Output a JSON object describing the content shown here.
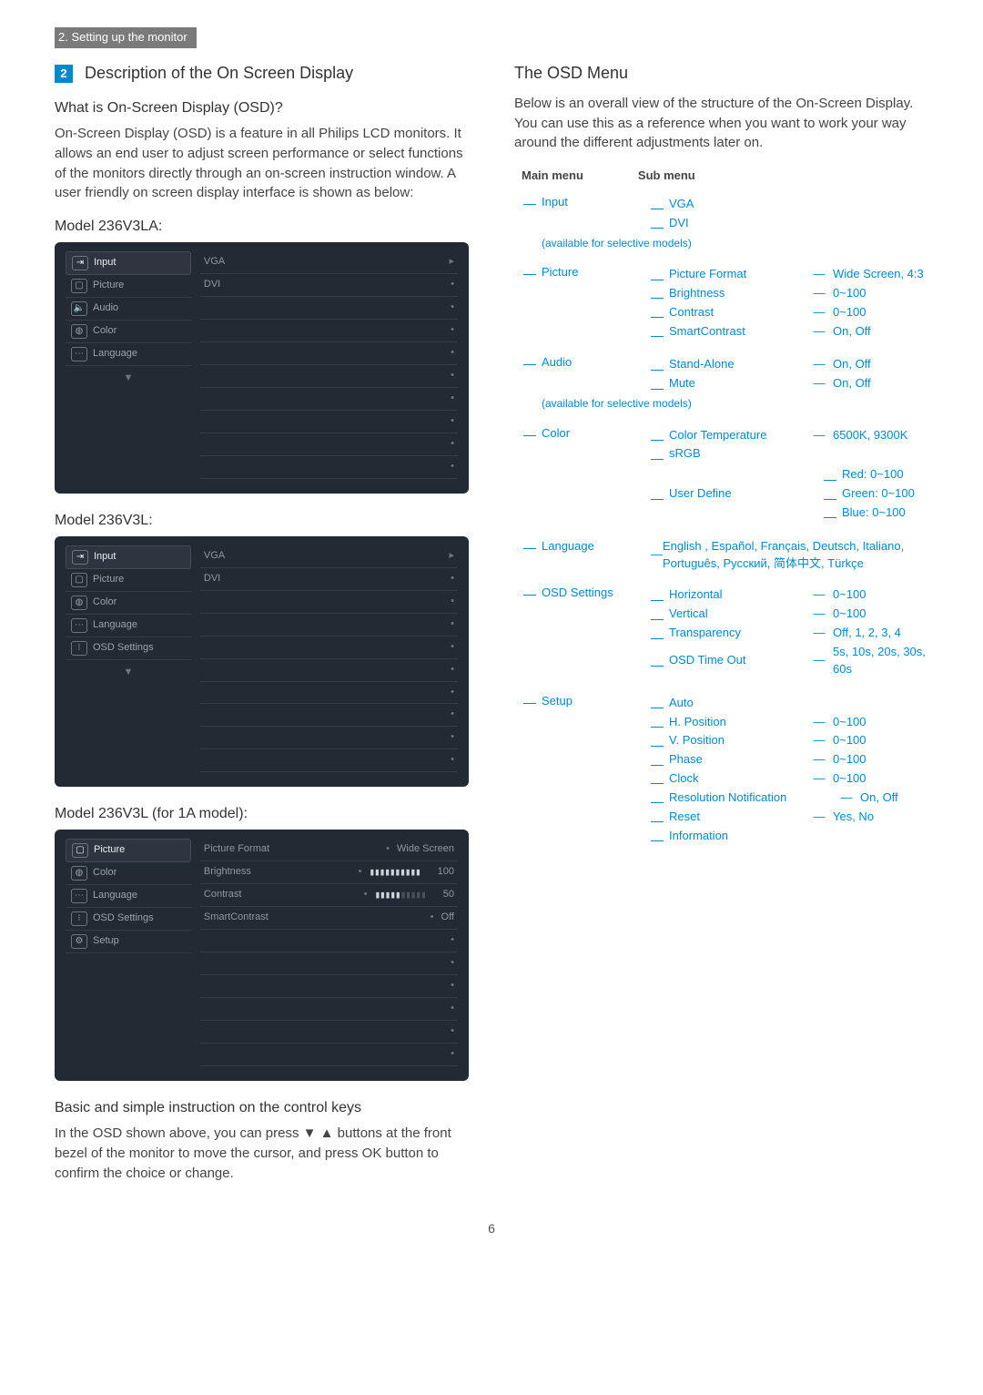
{
  "header": "2. Setting up the monitor",
  "section_number": "2",
  "section_title": "Description of the On Screen Display",
  "q_title": "What is On-Screen Display (OSD)?",
  "intro_para": "On-Screen Display (OSD) is a feature in all Philips LCD monitors. It allows an end user to adjust screen performance or select functions of the monitors directly through an on-screen instruction window. A user friendly on screen display interface is shown as below:",
  "model1_label": "Model 236V3LA:",
  "model2_label": "Model 236V3L:",
  "model3_label": "Model 236V3L (for 1A model):",
  "osd1": {
    "left": [
      "Input",
      "Picture",
      "Audio",
      "Color",
      "Language"
    ],
    "right_top": [
      "VGA",
      "DVI"
    ]
  },
  "osd2": {
    "left": [
      "Input",
      "Picture",
      "Color",
      "Language",
      "OSD Settings"
    ],
    "right_top": [
      "VGA",
      "DVI"
    ]
  },
  "osd3": {
    "left": [
      "Picture",
      "Color",
      "Language",
      "OSD Settings",
      "Setup"
    ],
    "right": [
      {
        "l": "Picture Format",
        "v": "Wide Screen"
      },
      {
        "l": "Brightness",
        "v": "100",
        "bar": "full"
      },
      {
        "l": "Contrast",
        "v": "50",
        "bar": "half"
      },
      {
        "l": "SmartContrast",
        "v": "Off"
      }
    ]
  },
  "basic_title": "Basic and simple instruction on the control keys",
  "basic_para": "In the OSD shown above, you can press ▼ ▲ buttons at the front bezel of the monitor to move the cursor, and press OK button to confirm the choice or change.",
  "osd_menu_title": "The OSD Menu",
  "osd_menu_para": "Below is an overall view of the structure of the On-Screen Display. You can use this as a reference when you want to work your way around the different adjustments later on.",
  "main_label": "Main menu",
  "sub_label": "Sub menu",
  "tree": {
    "input": {
      "name": "Input",
      "subs": [
        "VGA",
        "DVI"
      ],
      "note": "(available for selective models)"
    },
    "picture": {
      "name": "Picture",
      "rows": [
        {
          "s": "Picture Format",
          "v": "Wide Screen, 4:3"
        },
        {
          "s": "Brightness",
          "v": "0~100"
        },
        {
          "s": "Contrast",
          "v": "0~100"
        },
        {
          "s": "SmartContrast",
          "v": "On, Off"
        }
      ]
    },
    "audio": {
      "name": "Audio",
      "rows": [
        {
          "s": "Stand-Alone",
          "v": "On, Off"
        },
        {
          "s": "Mute",
          "v": "On, Off"
        }
      ],
      "note": "(available for selective models)"
    },
    "color": {
      "name": "Color",
      "rows": [
        {
          "s": "Color Temperature",
          "v": "6500K, 9300K"
        },
        {
          "s": "sRGB",
          "v": ""
        },
        {
          "s": "User Define",
          "v": ""
        }
      ],
      "user_define": [
        "Red: 0~100",
        "Green: 0~100",
        "Blue: 0~100"
      ]
    },
    "language": {
      "name": "Language",
      "langs": "English , Español, Français, Deutsch, Italiano, Português, Русский, 简体中文, Türkçe"
    },
    "osd_settings": {
      "name": "OSD Settings",
      "rows": [
        {
          "s": "Horizontal",
          "v": "0~100"
        },
        {
          "s": "Vertical",
          "v": "0~100"
        },
        {
          "s": "Transparency",
          "v": "Off, 1, 2, 3, 4"
        },
        {
          "s": "OSD Time Out",
          "v": "5s, 10s, 20s, 30s, 60s"
        }
      ]
    },
    "setup": {
      "name": "Setup",
      "rows": [
        {
          "s": "Auto",
          "v": ""
        },
        {
          "s": "H. Position",
          "v": "0~100"
        },
        {
          "s": "V. Position",
          "v": "0~100"
        },
        {
          "s": "Phase",
          "v": "0~100"
        },
        {
          "s": "Clock",
          "v": "0~100"
        },
        {
          "s": "Resolution Notification",
          "v": "On, Off"
        },
        {
          "s": "Reset",
          "v": "Yes, No"
        },
        {
          "s": "Information",
          "v": ""
        }
      ]
    }
  },
  "page_number": "6"
}
